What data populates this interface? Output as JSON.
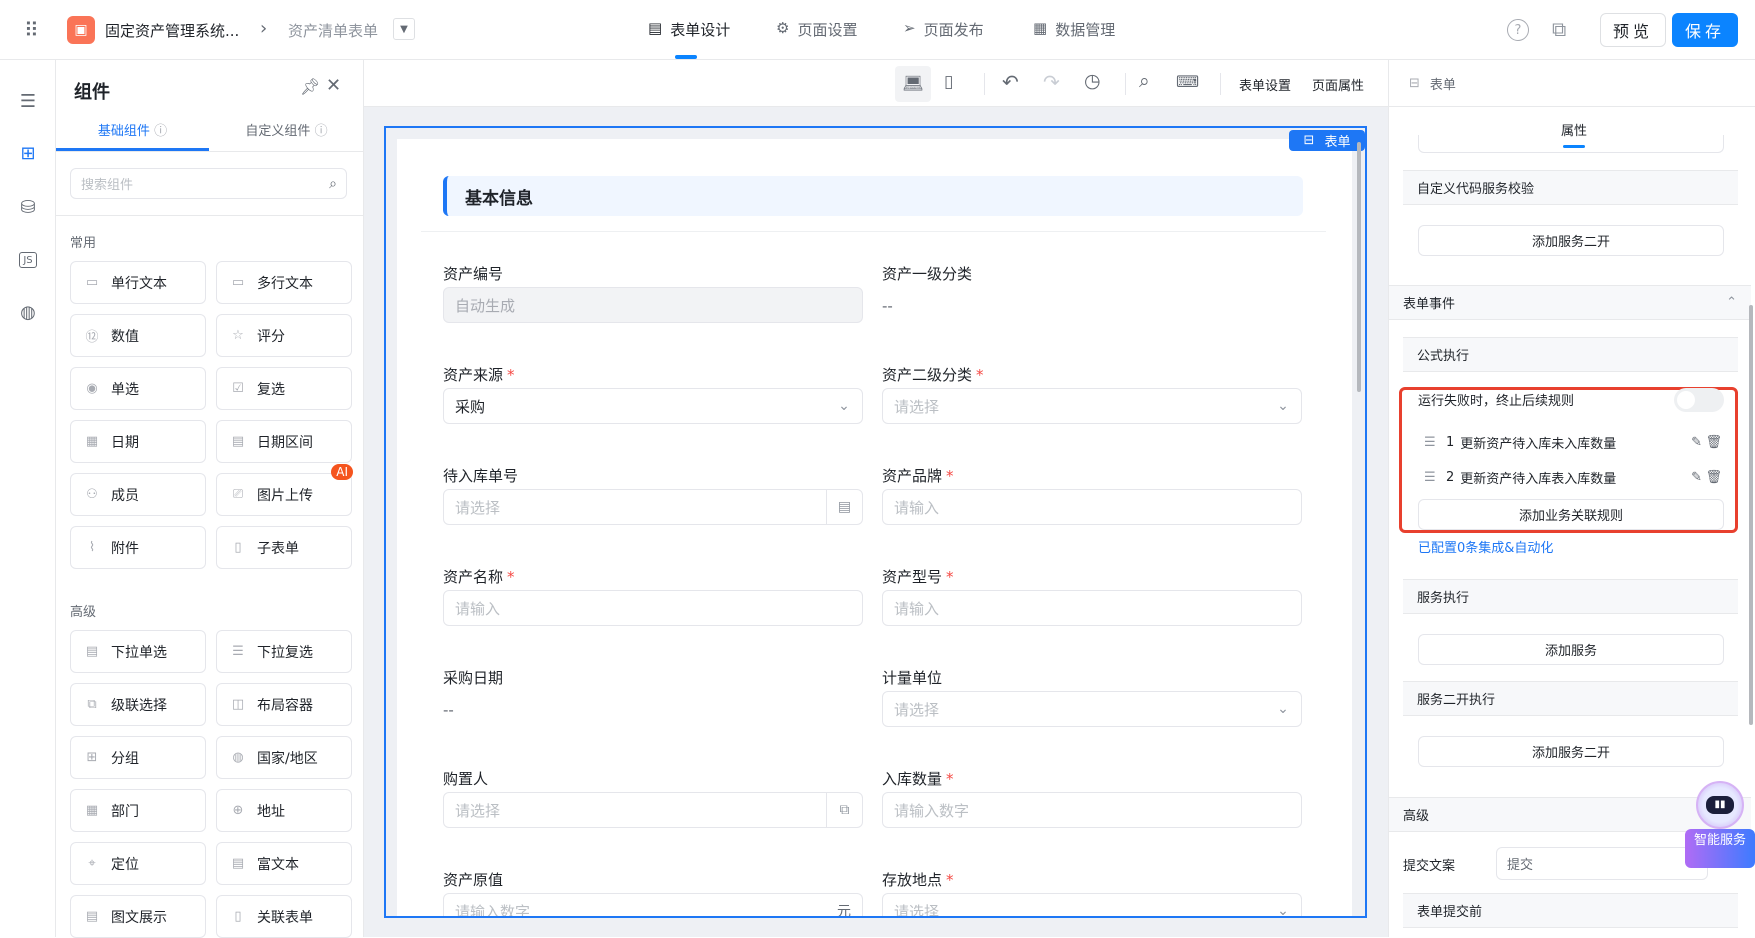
{
  "topbar": {
    "app_title": "固定资产管理系统...",
    "breadcrumb_current": "资产清单表单",
    "tabs": [
      {
        "label": "表单设计",
        "icon": "document-icon",
        "active": true
      },
      {
        "label": "页面设置",
        "icon": "gear-icon"
      },
      {
        "label": "页面发布",
        "icon": "send-icon"
      },
      {
        "label": "数据管理",
        "icon": "table-icon"
      }
    ],
    "preview_label": "预览",
    "save_label": "保存",
    "accent": "#0b84ff"
  },
  "components_panel": {
    "title": "组件",
    "tabs": [
      {
        "label": "基础组件",
        "active": true
      },
      {
        "label": "自定义组件"
      }
    ],
    "search_placeholder": "搜索组件",
    "groups": [
      {
        "label": "常用",
        "items": [
          {
            "label": "单行文本",
            "icon": "input-icon"
          },
          {
            "label": "多行文本",
            "icon": "textarea-icon"
          },
          {
            "label": "数值",
            "icon": "number-icon"
          },
          {
            "label": "评分",
            "icon": "star-icon"
          },
          {
            "label": "单选",
            "icon": "radio-icon"
          },
          {
            "label": "复选",
            "icon": "checkbox-icon"
          },
          {
            "label": "日期",
            "icon": "calendar-icon"
          },
          {
            "label": "日期区间",
            "icon": "date-range-icon"
          },
          {
            "label": "成员",
            "icon": "user-icon"
          },
          {
            "label": "图片上传",
            "icon": "image-icon",
            "badge": "AI"
          },
          {
            "label": "附件",
            "icon": "paperclip-icon"
          },
          {
            "label": "子表单",
            "icon": "subform-icon"
          }
        ]
      },
      {
        "label": "高级",
        "items": [
          {
            "label": "下拉单选",
            "icon": "dropdown-icon"
          },
          {
            "label": "下拉复选",
            "icon": "multi-dropdown-icon"
          },
          {
            "label": "级联选择",
            "icon": "cascade-icon"
          },
          {
            "label": "布局容器",
            "icon": "layout-icon"
          },
          {
            "label": "分组",
            "icon": "group-icon"
          },
          {
            "label": "国家/地区",
            "icon": "globe-icon"
          },
          {
            "label": "部门",
            "icon": "department-icon"
          },
          {
            "label": "地址",
            "icon": "address-icon"
          },
          {
            "label": "定位",
            "icon": "location-icon"
          },
          {
            "label": "富文本",
            "icon": "richtext-icon"
          },
          {
            "label": "图文展示",
            "icon": "image-text-icon"
          },
          {
            "label": "关联表单",
            "icon": "link-form-icon"
          }
        ]
      }
    ]
  },
  "canvas_toolbar": {
    "form_settings": "表单设置",
    "page_props": "页面属性"
  },
  "form": {
    "badge": "表单",
    "section_title": "基本信息",
    "left": [
      {
        "label": "资产编号",
        "kind": "input",
        "value": "自动生成",
        "disabled": true
      },
      {
        "label": "资产来源",
        "required": true,
        "kind": "select",
        "value": "采购"
      },
      {
        "label": "待入库单号",
        "kind": "picker",
        "placeholder": "请选择"
      },
      {
        "label": "资产名称",
        "required": true,
        "kind": "input",
        "placeholder": "请输入"
      },
      {
        "label": "采购日期",
        "kind": "text",
        "value": "--"
      },
      {
        "label": "购置人",
        "kind": "picker2",
        "placeholder": "请选择"
      },
      {
        "label": "资产原值",
        "kind": "unit",
        "placeholder": "请输入数字",
        "unit": "元"
      }
    ],
    "right": [
      {
        "label": "资产一级分类",
        "kind": "text",
        "value": "--"
      },
      {
        "label": "资产二级分类",
        "required": true,
        "kind": "select",
        "placeholder": "请选择"
      },
      {
        "label": "资产品牌",
        "required": true,
        "kind": "input",
        "placeholder": "请输入"
      },
      {
        "label": "资产型号",
        "required": true,
        "kind": "input",
        "placeholder": "请输入"
      },
      {
        "label": "计量单位",
        "kind": "select",
        "placeholder": "请选择"
      },
      {
        "label": "入库数量",
        "required": true,
        "kind": "input",
        "placeholder": "请输入数字"
      },
      {
        "label": "存放地点",
        "required": true,
        "kind": "select",
        "placeholder": "请选择"
      }
    ]
  },
  "props_panel": {
    "header": "表单",
    "tab": "属性",
    "custom_code_validation": "自定义代码服务校验",
    "add_service_dev_1": "添加服务二开",
    "form_events": "表单事件",
    "formula_exec": "公式执行",
    "stop_on_fail_label": "运行失败时，终止后续规则",
    "stop_on_fail": false,
    "rules": [
      {
        "index": "1",
        "name": "更新资产待入库未入库数量"
      },
      {
        "index": "2",
        "name": "更新资产待入库表入库数量"
      }
    ],
    "add_rule": "添加业务关联规则",
    "integration_link": "已配置0条集成&自动化",
    "service_exec": "服务执行",
    "add_service": "添加服务",
    "service_dev_exec": "服务二开执行",
    "add_service_dev_2": "添加服务二开",
    "advanced": "高级",
    "submit_text_label": "提交文案",
    "submit_text_value": "提交",
    "before_submit": "表单提交前",
    "highlight_color": "#e8402e"
  },
  "assistant": {
    "label": "智能服务"
  }
}
